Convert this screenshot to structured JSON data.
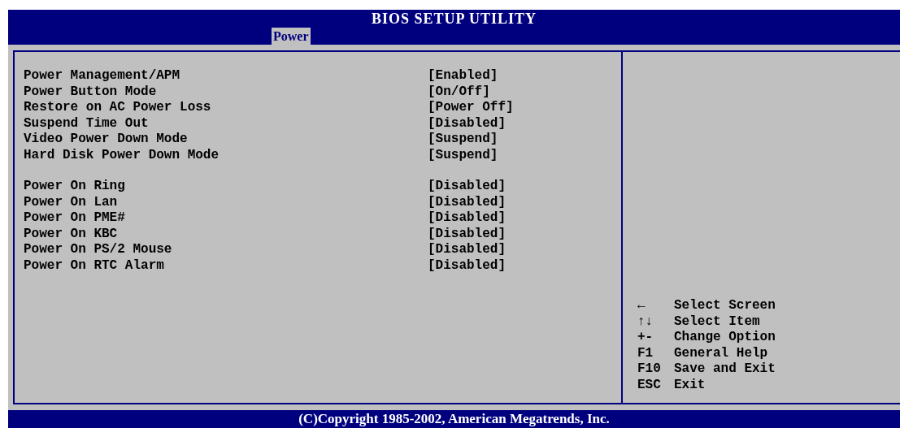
{
  "window": {
    "title": "BIOS SETUP UTILITY"
  },
  "tabs": [
    {
      "label": "Power",
      "selected": true
    }
  ],
  "settings": {
    "groups": [
      [
        {
          "label": "Power Management/APM",
          "value": "[Enabled]"
        },
        {
          "label": "Power Button Mode",
          "value": "[On/Off]"
        },
        {
          "label": "Restore on AC Power Loss",
          "value": "[Power Off]"
        },
        {
          "label": "Suspend Time Out",
          "value": "[Disabled]"
        },
        {
          "label": "Video Power Down Mode",
          "value": "[Suspend]"
        },
        {
          "label": "Hard Disk Power Down Mode",
          "value": "[Suspend]"
        }
      ],
      [
        {
          "label": "Power On Ring",
          "value": "[Disabled]"
        },
        {
          "label": "Power On Lan",
          "value": "[Disabled]"
        },
        {
          "label": "Power On PME#",
          "value": "[Disabled]"
        },
        {
          "label": "Power On KBC",
          "value": "[Disabled]"
        },
        {
          "label": "Power On PS/2 Mouse",
          "value": "[Disabled]"
        },
        {
          "label": "Power On RTC Alarm",
          "value": "[Disabled]"
        }
      ]
    ]
  },
  "help": [
    {
      "key": "←",
      "action": "Select Screen"
    },
    {
      "key": "↑↓",
      "action": "Select Item"
    },
    {
      "key": "+-",
      "action": "Change Option"
    },
    {
      "key": "F1",
      "action": "General Help"
    },
    {
      "key": "F10",
      "action": "Save and Exit"
    },
    {
      "key": "ESC",
      "action": "Exit"
    }
  ],
  "status_bar": "(C)Copyright 1985-2002, American Megatrends, Inc."
}
